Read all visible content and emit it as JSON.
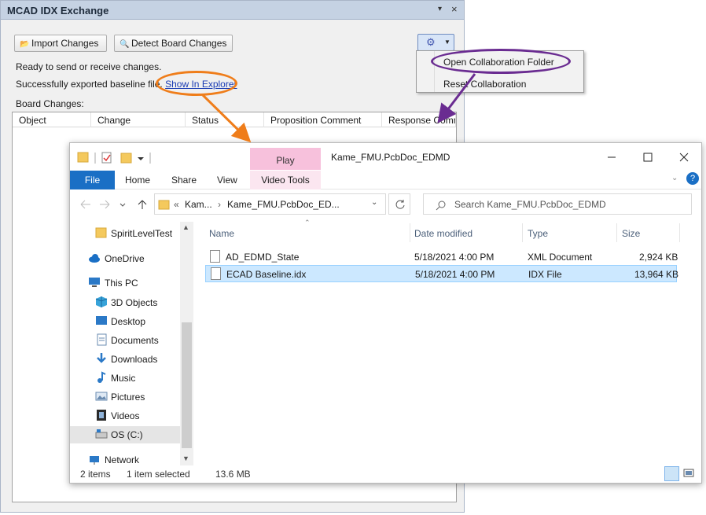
{
  "mcad": {
    "title": "MCAD IDX Exchange",
    "pin_icon": "▾",
    "close_icon": "×",
    "import_label": "Import Changes",
    "detect_label": "Detect Board Changes",
    "status_line": "Ready to send or receive changes.",
    "export_line": "Successfully exported baseline file.",
    "explorer_link": "Show In Explorer",
    "board_changes_label": "Board Changes:",
    "columns": [
      "Object",
      "Change",
      "Status",
      "Proposition Comment",
      "Response Comme"
    ]
  },
  "menu": {
    "open_collab": "Open Collaboration Folder",
    "reset_collab": "Reset Collaboration"
  },
  "explorer": {
    "title": "Kame_FMU.PcbDoc_EDMD",
    "play_tab": "Play",
    "ribbon": {
      "file": "File",
      "home": "Home",
      "share": "Share",
      "view": "View",
      "video_tools": "Video Tools"
    },
    "breadcrumb": {
      "chevron": "«",
      "part1": "Kam...",
      "part2": "Kame_FMU.PcbDoc_ED..."
    },
    "search_placeholder": "Search Kame_FMU.PcbDoc_EDMD",
    "nav": [
      {
        "label": "SpiritLevelTest",
        "icon": "folder-icon"
      },
      {
        "label": "OneDrive",
        "icon": "cloud-icon"
      },
      {
        "label": "This PC",
        "icon": "computer-icon"
      },
      {
        "label": "3D Objects",
        "icon": "cube-icon"
      },
      {
        "label": "Desktop",
        "icon": "desktop-icon"
      },
      {
        "label": "Documents",
        "icon": "documents-icon"
      },
      {
        "label": "Downloads",
        "icon": "download-icon"
      },
      {
        "label": "Music",
        "icon": "music-icon"
      },
      {
        "label": "Pictures",
        "icon": "pictures-icon"
      },
      {
        "label": "Videos",
        "icon": "videos-icon"
      },
      {
        "label": "OS (C:)",
        "icon": "drive-icon"
      },
      {
        "label": "Network",
        "icon": "network-icon"
      }
    ],
    "columns": {
      "name": "Name",
      "date": "Date modified",
      "type": "Type",
      "size": "Size"
    },
    "files": [
      {
        "name": "AD_EDMD_State",
        "date": "5/18/2021 4:00 PM",
        "type": "XML Document",
        "size": "2,924 KB"
      },
      {
        "name": "ECAD Baseline.idx",
        "date": "5/18/2021 4:00 PM",
        "type": "IDX File",
        "size": "13,964 KB"
      }
    ],
    "status": {
      "items": "2 items",
      "selected": "1 item selected",
      "size": "13.6 MB"
    }
  },
  "colors": {
    "orange": "#ef7d1a",
    "purple": "#6a2c91",
    "file_blue": "#1a6fc5",
    "play_pink": "#f7c1dc",
    "selection": "#cce8ff"
  }
}
